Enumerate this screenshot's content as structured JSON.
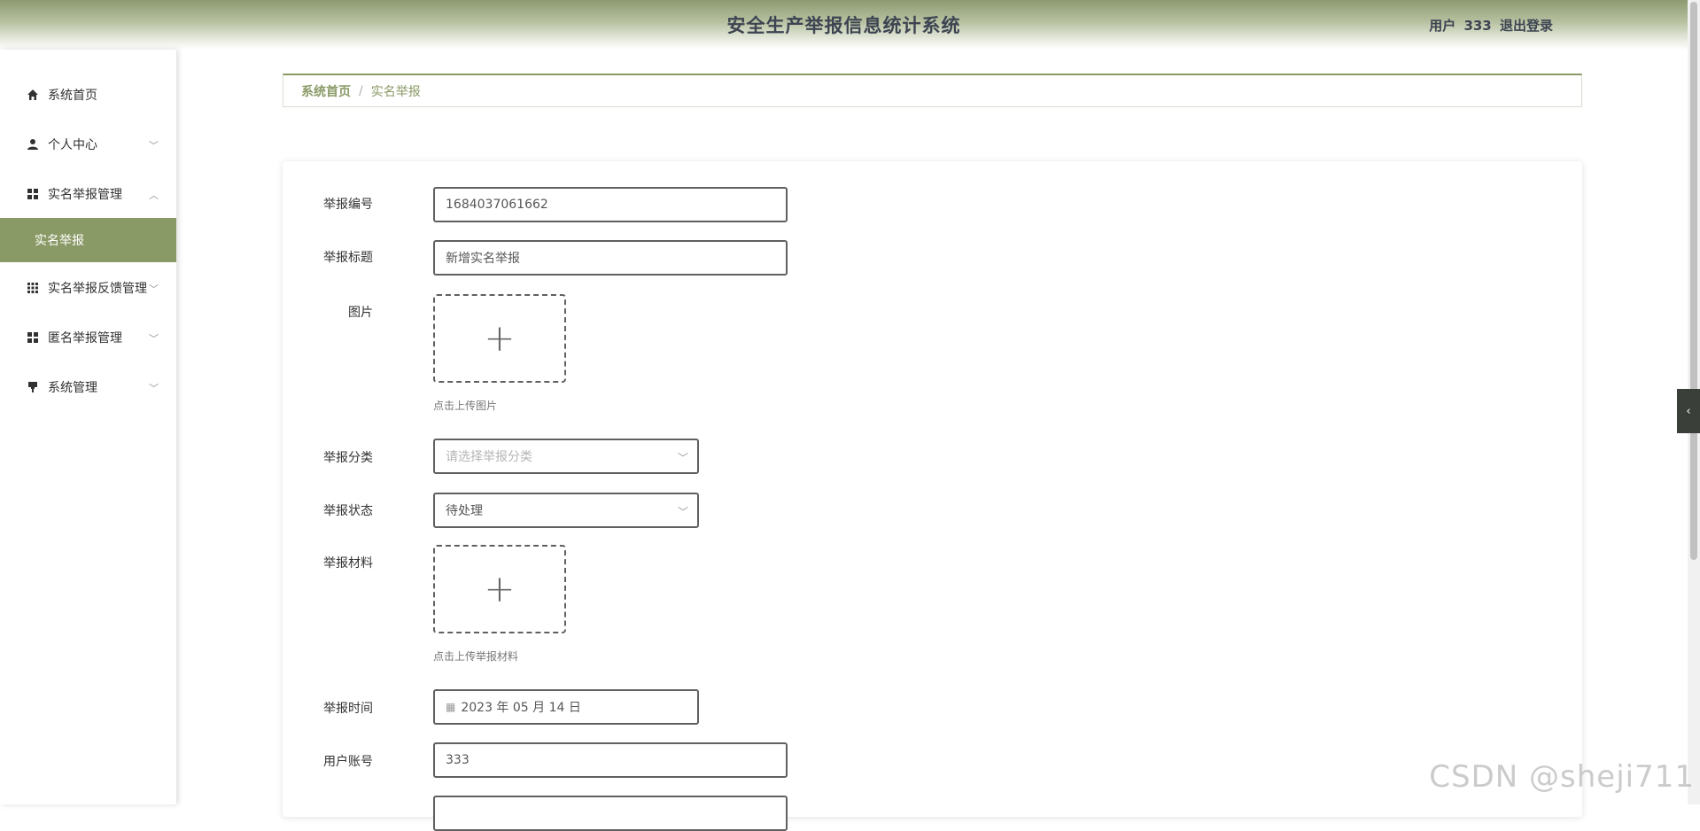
{
  "header": {
    "title": "安全生产举报信息统计系统",
    "user_label": "用户",
    "user_name": "333",
    "logout_label": "退出登录"
  },
  "sidebar": {
    "items": [
      {
        "label": "系统首页",
        "icon": "home-icon"
      },
      {
        "label": "个人中心",
        "icon": "user-icon"
      },
      {
        "label": "实名举报管理",
        "icon": "grid-icon"
      },
      {
        "label": "实名举报",
        "icon": ""
      },
      {
        "label": "实名举报反馈管理",
        "icon": "grid9-icon"
      },
      {
        "label": "匿名举报管理",
        "icon": "grid-icon"
      },
      {
        "label": "系统管理",
        "icon": "brush-icon"
      }
    ]
  },
  "breadcrumb": {
    "home": "系统首页",
    "separator": "/",
    "current": "实名举报"
  },
  "form": {
    "report_no_label": "举报编号",
    "report_no_value": "1684037061662",
    "title_label": "举报标题",
    "title_value": "新增实名举报",
    "image_label": "图片",
    "image_hint": "点击上传图片",
    "category_label": "举报分类",
    "category_placeholder": "请选择举报分类",
    "status_label": "举报状态",
    "status_value": "待处理",
    "material_label": "举报材料",
    "material_hint": "点击上传举报材料",
    "time_label": "举报时间",
    "time_value": "2023 年 05 月 14 日",
    "account_label": "用户账号",
    "account_value": "333"
  },
  "watermark": "CSDN @sheji711",
  "colors": {
    "accent": "#8a9a66",
    "header_top": "#8c9a70",
    "title_text": "#3d4452"
  }
}
